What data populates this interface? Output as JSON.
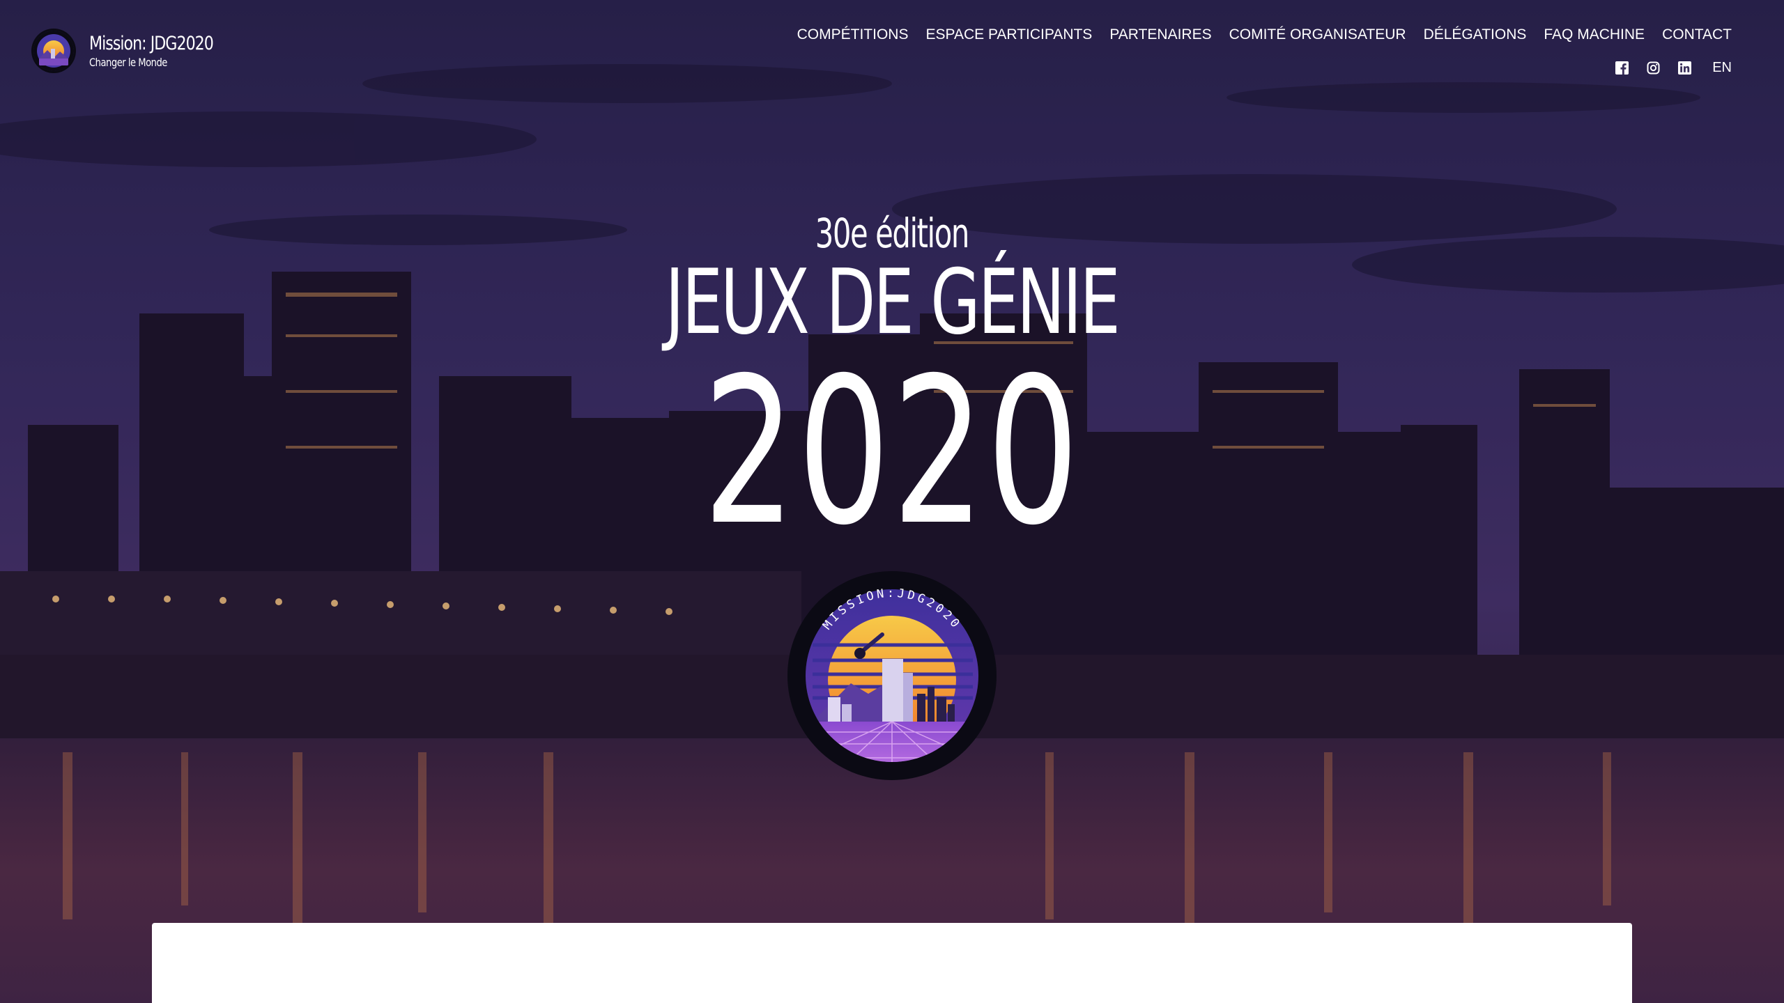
{
  "brand": {
    "title": "Mission: JDG2020",
    "subtitle": "Changer le Monde"
  },
  "nav": {
    "items": [
      "COMPÉTITIONS",
      "ESPACE PARTICIPANTS",
      "PARTENAIRES",
      "COMITÉ ORGANISATEUR",
      "DÉLÉGATIONS",
      "FAQ MACHINE",
      "CONTACT"
    ]
  },
  "social": {
    "icons": [
      "facebook-icon",
      "instagram-icon",
      "linkedin-icon"
    ],
    "language": "EN"
  },
  "hero": {
    "edition": "30e édition",
    "title": "JEUX DE GÉNIE",
    "year": "2020",
    "badge_text": "MISSION:JDG2020"
  },
  "colors": {
    "overlay": "#2a1f4a",
    "text": "#ffffff",
    "badge_sun_top": "#f7c948",
    "badge_sun_bottom": "#f0782a",
    "badge_sky": "#4a3aa8",
    "badge_ring": "#0b0a14"
  }
}
